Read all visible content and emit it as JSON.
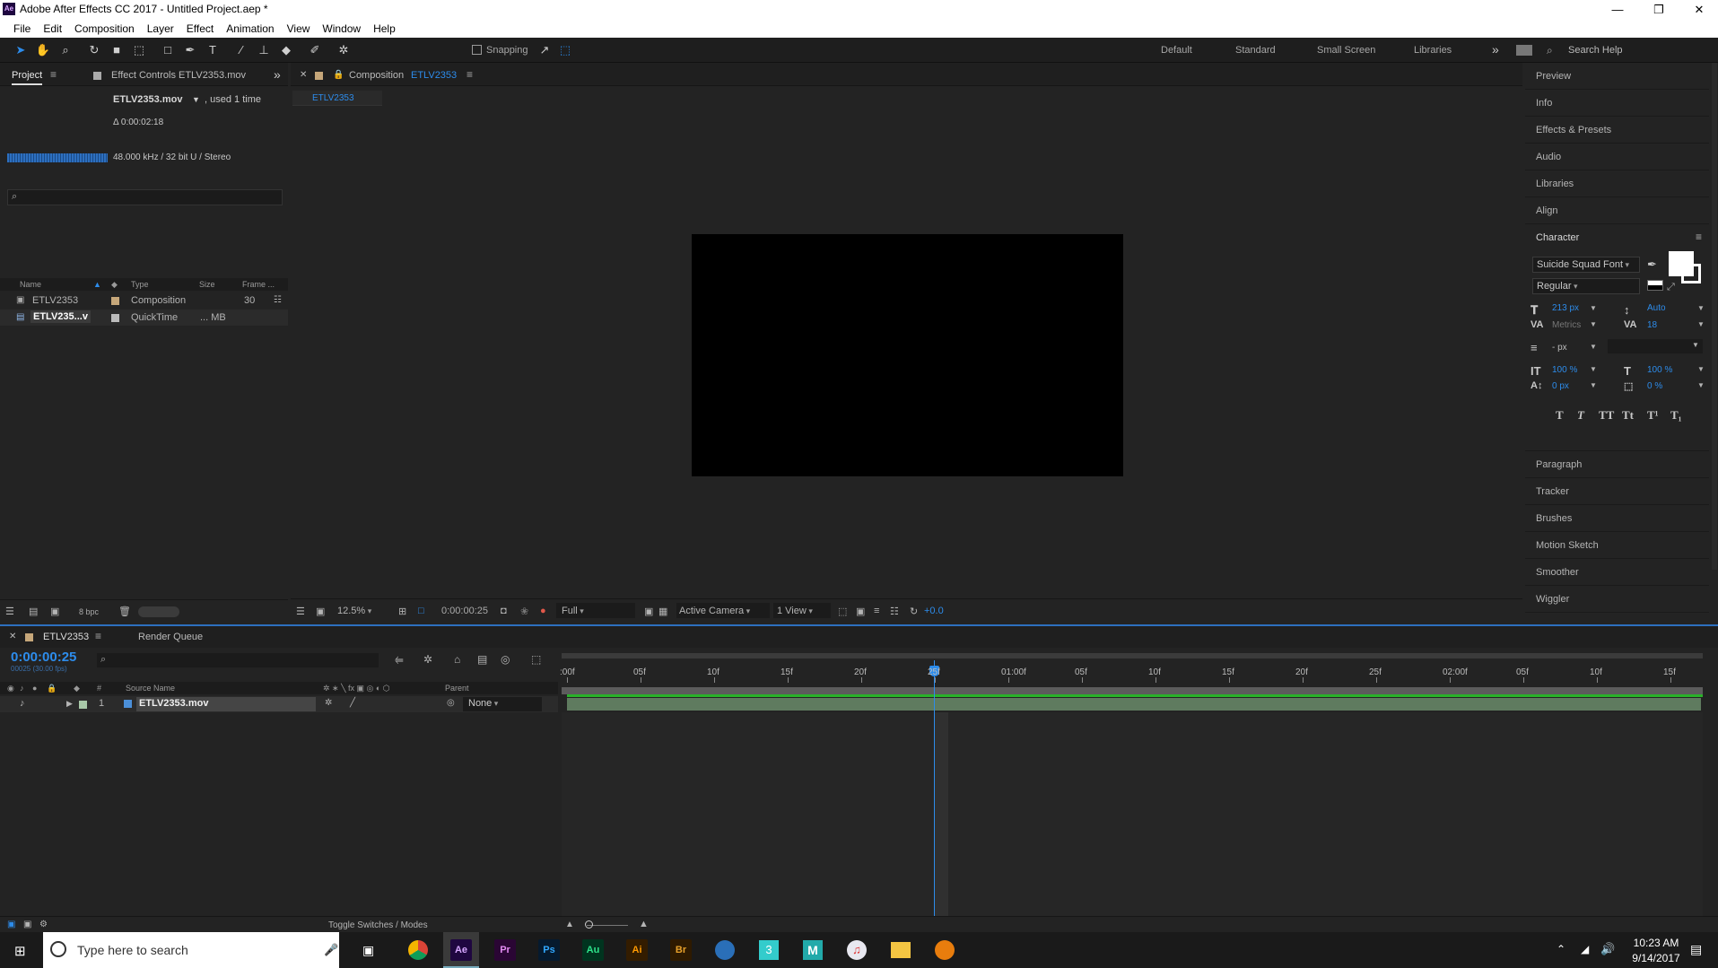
{
  "window": {
    "title": "Adobe After Effects CC 2017 - Untitled Project.aep *",
    "logo": "Ae",
    "min": "—",
    "restore": "❐",
    "close": "✕"
  },
  "menu": [
    "File",
    "Edit",
    "Composition",
    "Layer",
    "Effect",
    "Animation",
    "View",
    "Window",
    "Help"
  ],
  "toolbar": {
    "snapping": "Snapping",
    "workspaces": [
      "Default",
      "Standard",
      "Small Screen",
      "Libraries"
    ],
    "more": "»",
    "search_placeholder": "Search Help"
  },
  "project": {
    "tab_project": "Project",
    "tab_effect_controls": "Effect Controls ETLV2353.mov",
    "expand": "»",
    "item_name": "ETLV2353.mov",
    "item_used": ", used 1 time",
    "item_duration": "Δ 0:00:02:18",
    "item_audio": "48.000 kHz / 32 bit U / Stereo",
    "columns": {
      "name": "Name",
      "type": "Type",
      "size": "Size",
      "frame": "Frame ..."
    },
    "items": [
      {
        "name": "ETLV2353",
        "type": "Composition",
        "size": "",
        "frame": "30"
      },
      {
        "name": "ETLV235...v",
        "type": "QuickTime",
        "size": "... MB",
        "frame": ""
      }
    ],
    "bpc": "8 bpc"
  },
  "comp": {
    "tab_prefix": "Composition",
    "tab_name": "ETLV2353",
    "subtab": "ETLV2353",
    "zoom": "12.5%",
    "timecode": "0:00:00:25",
    "resolution": "Full",
    "camera": "Active Camera",
    "views": "1 View",
    "exposure": "+0.0"
  },
  "right_panels": {
    "top": [
      "Preview",
      "Info",
      "Effects & Presets",
      "Audio",
      "Libraries",
      "Align"
    ],
    "bottom": [
      "Paragraph",
      "Tracker",
      "Brushes",
      "Motion Sketch",
      "Smoother",
      "Wiggler"
    ]
  },
  "character": {
    "title": "Character",
    "font": "Suicide Squad Font",
    "style": "Regular",
    "font_size": "213 px",
    "leading": "Auto",
    "kerning": "Metrics",
    "tracking": "18",
    "stroke_width": "- px",
    "vert_scale": "100 %",
    "horiz_scale": "100 %",
    "baseline": "0 px",
    "tsume": "0 %",
    "text_styles": [
      "T",
      "T",
      "TT",
      "Tt",
      "T¹",
      "T₁"
    ]
  },
  "timeline": {
    "tab_comp": "ETLV2353",
    "tab_render": "Render Queue",
    "timecode": "0:00:00:25",
    "timecode_sub": "00025 (30.00 fps)",
    "col_num": "#",
    "col_source": "Source Name",
    "col_parent": "Parent",
    "layer": {
      "num": "1",
      "name": "ETLV2353.mov",
      "parent": "None"
    },
    "ruler": [
      ":00f",
      "05f",
      "10f",
      "15f",
      "20f",
      "25f",
      "01:00f",
      "05f",
      "10f",
      "15f",
      "20f",
      "25f",
      "02:00f",
      "05f",
      "10f",
      "15f"
    ],
    "toggle": "Toggle Switches / Modes"
  },
  "taskbar": {
    "search_placeholder": "Type here to search",
    "time": "10:23 AM",
    "date": "9/14/2017",
    "apps": [
      "Ae",
      "Pr",
      "Ps",
      "Au",
      "Ai",
      "Br"
    ]
  },
  "colors": {
    "accent": "#2d8ceb",
    "comp_label": "#c6a77a",
    "layer_bar": "#5f7b5f"
  }
}
